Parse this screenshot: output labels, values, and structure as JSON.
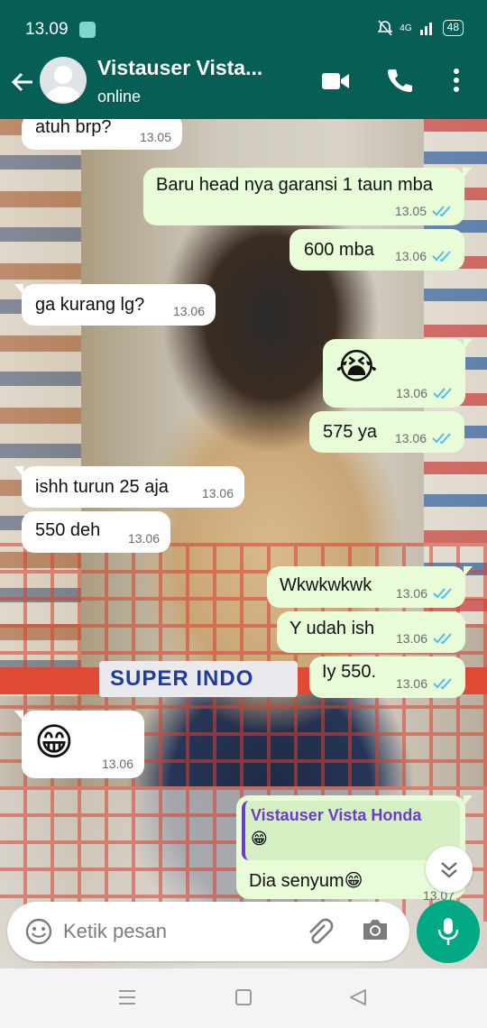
{
  "status_bar": {
    "time": "13.09",
    "network": "4G",
    "battery": "48",
    "icons": [
      "message-notification-icon",
      "mute-alarm-icon",
      "signal-icon",
      "battery-icon"
    ]
  },
  "header": {
    "contact_name": "Vistauser Vista...",
    "status": "online",
    "icons": [
      "back-arrow-icon",
      "avatar-icon",
      "video-call-icon",
      "phone-icon",
      "more-vert-icon"
    ]
  },
  "messages": [
    {
      "dir": "in",
      "text": "atuh brp?",
      "time": "13.05"
    },
    {
      "dir": "out",
      "text": "Baru head nya garansi 1 taun mba",
      "time": "13.05",
      "read": true
    },
    {
      "dir": "out",
      "text": "600 mba",
      "time": "13.06",
      "read": true
    },
    {
      "dir": "in",
      "text": "ga kurang lg?",
      "time": "13.06"
    },
    {
      "dir": "out",
      "text": "😭",
      "time": "13.06",
      "read": true
    },
    {
      "dir": "out",
      "text": "575 ya",
      "time": "13.06",
      "read": true
    },
    {
      "dir": "in",
      "text": "ishh turun 25 aja",
      "time": "13.06"
    },
    {
      "dir": "in",
      "text": "550 deh",
      "time": "13.06"
    },
    {
      "dir": "out",
      "text": "Wkwkwkwk",
      "time": "13.06",
      "read": true
    },
    {
      "dir": "out",
      "text": "Y udah ish",
      "time": "13.06",
      "read": true
    },
    {
      "dir": "out",
      "text": "Iy 550.",
      "time": "13.06",
      "read": true
    },
    {
      "dir": "in",
      "text": "😁",
      "time": "13.06"
    }
  ],
  "reply_message": {
    "quoted_name": "Vistauser Vista Honda",
    "quoted_text": "😁",
    "text": "Dia senyum😁",
    "time": "13.07"
  },
  "background_text": "SUPER INDO",
  "input": {
    "placeholder": "Ketik pesan",
    "icons": [
      "emoji-icon",
      "attach-icon",
      "camera-icon",
      "mic-icon"
    ]
  },
  "nav": {
    "icons": [
      "menu-icon",
      "home-icon",
      "back-icon"
    ]
  },
  "colors": {
    "header": "#075e54",
    "out_bubble": "#e7fcd7",
    "in_bubble": "#ffffff",
    "accent": "#00a884",
    "ticks": "#53bdeb",
    "quote_name": "#6a3fc7"
  }
}
